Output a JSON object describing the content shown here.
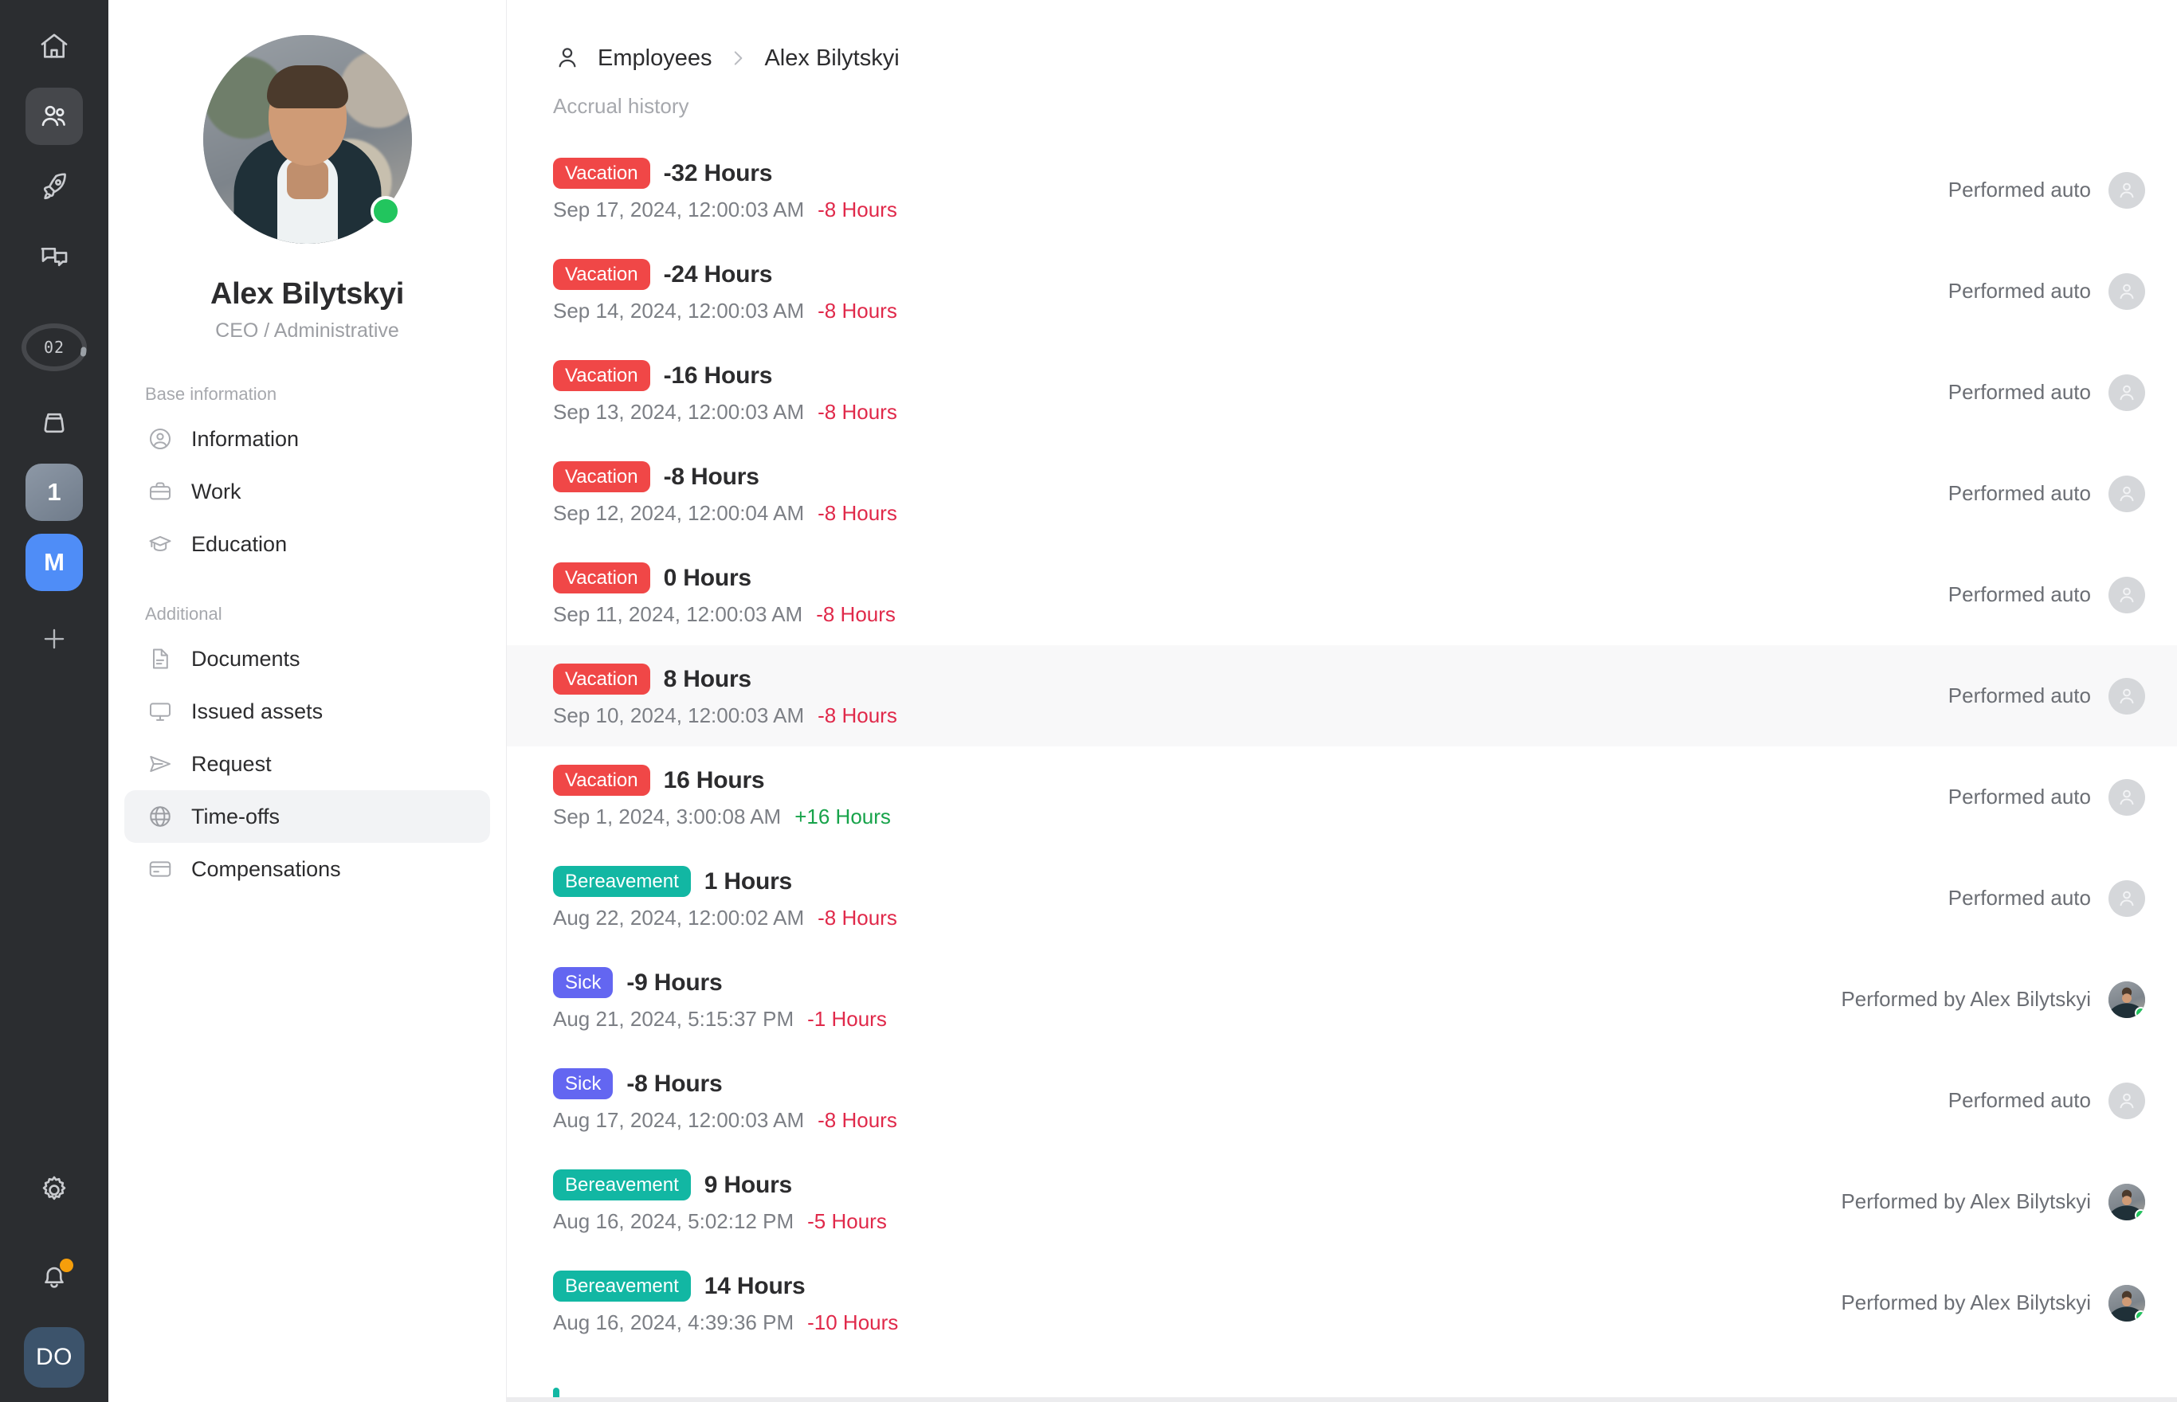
{
  "rail": {
    "items": [
      {
        "name": "home",
        "icon": "home-icon",
        "active": false
      },
      {
        "name": "employees",
        "icon": "people-icon",
        "active": true
      },
      {
        "name": "projects",
        "icon": "rocket-icon",
        "active": false
      },
      {
        "name": "chat",
        "icon": "chat-icon",
        "active": false
      }
    ],
    "ring_label": "02",
    "box_icon": "box-icon",
    "chips": [
      {
        "label": "1",
        "style": "one"
      },
      {
        "label": "M",
        "style": "m"
      }
    ],
    "add_icon": "plus-icon",
    "settings_icon": "gear-icon",
    "notifications_icon": "bell-icon",
    "notifications_badge": true,
    "user_initials": "DO"
  },
  "profile": {
    "name": "Alex Bilytskyi",
    "role": "CEO / Administrative",
    "status": "online"
  },
  "sidebar": {
    "sections": [
      {
        "title": "Base information",
        "items": [
          {
            "label": "Information",
            "icon": "user-circle-icon",
            "active": false
          },
          {
            "label": "Work",
            "icon": "briefcase-icon",
            "active": false
          },
          {
            "label": "Education",
            "icon": "graduation-cap-icon",
            "active": false
          }
        ]
      },
      {
        "title": "Additional",
        "items": [
          {
            "label": "Documents",
            "icon": "document-icon",
            "active": false
          },
          {
            "label": "Issued assets",
            "icon": "monitor-icon",
            "active": false
          },
          {
            "label": "Request",
            "icon": "send-icon",
            "active": false
          },
          {
            "label": "Time-offs",
            "icon": "globe-icon",
            "active": true
          },
          {
            "label": "Compensations",
            "icon": "card-icon",
            "active": false
          }
        ]
      }
    ]
  },
  "breadcrumb": {
    "icon": "person-icon",
    "root": "Employees",
    "separator": "chevron-right-icon",
    "current": "Alex Bilytskyi"
  },
  "main": {
    "section_title": "Accrual history",
    "rows": [
      {
        "type": "Vacation",
        "type_style": "vacation",
        "hours": "-32 Hours",
        "datetime": "Sep 17, 2024, 12:00:03 AM",
        "delta": "-8 Hours",
        "delta_sign": "neg",
        "performer": "Performed auto",
        "performer_avatar": "auto",
        "highlighted": false
      },
      {
        "type": "Vacation",
        "type_style": "vacation",
        "hours": "-24 Hours",
        "datetime": "Sep 14, 2024, 12:00:03 AM",
        "delta": "-8 Hours",
        "delta_sign": "neg",
        "performer": "Performed auto",
        "performer_avatar": "auto",
        "highlighted": false
      },
      {
        "type": "Vacation",
        "type_style": "vacation",
        "hours": "-16 Hours",
        "datetime": "Sep 13, 2024, 12:00:03 AM",
        "delta": "-8 Hours",
        "delta_sign": "neg",
        "performer": "Performed auto",
        "performer_avatar": "auto",
        "highlighted": false
      },
      {
        "type": "Vacation",
        "type_style": "vacation",
        "hours": "-8 Hours",
        "datetime": "Sep 12, 2024, 12:00:04 AM",
        "delta": "-8 Hours",
        "delta_sign": "neg",
        "performer": "Performed auto",
        "performer_avatar": "auto",
        "highlighted": false
      },
      {
        "type": "Vacation",
        "type_style": "vacation",
        "hours": "0 Hours",
        "datetime": "Sep 11, 2024, 12:00:03 AM",
        "delta": "-8 Hours",
        "delta_sign": "neg",
        "performer": "Performed auto",
        "performer_avatar": "auto",
        "highlighted": false
      },
      {
        "type": "Vacation",
        "type_style": "vacation",
        "hours": "8 Hours",
        "datetime": "Sep 10, 2024, 12:00:03 AM",
        "delta": "-8 Hours",
        "delta_sign": "neg",
        "performer": "Performed auto",
        "performer_avatar": "auto",
        "highlighted": true
      },
      {
        "type": "Vacation",
        "type_style": "vacation",
        "hours": "16 Hours",
        "datetime": "Sep 1, 2024, 3:00:08 AM",
        "delta": "+16 Hours",
        "delta_sign": "pos",
        "performer": "Performed auto",
        "performer_avatar": "auto",
        "highlighted": false
      },
      {
        "type": "Bereavement",
        "type_style": "bereavement",
        "hours": "1 Hours",
        "datetime": "Aug 22, 2024, 12:00:02 AM",
        "delta": "-8 Hours",
        "delta_sign": "neg",
        "performer": "Performed auto",
        "performer_avatar": "auto",
        "highlighted": false
      },
      {
        "type": "Sick",
        "type_style": "sick",
        "hours": "-9 Hours",
        "datetime": "Aug 21, 2024, 5:15:37 PM",
        "delta": "-1 Hours",
        "delta_sign": "neg",
        "performer": "Performed by Alex Bilytskyi",
        "performer_avatar": "photo",
        "highlighted": false
      },
      {
        "type": "Sick",
        "type_style": "sick",
        "hours": "-8 Hours",
        "datetime": "Aug 17, 2024, 12:00:03 AM",
        "delta": "-8 Hours",
        "delta_sign": "neg",
        "performer": "Performed auto",
        "performer_avatar": "auto",
        "highlighted": false
      },
      {
        "type": "Bereavement",
        "type_style": "bereavement",
        "hours": "9 Hours",
        "datetime": "Aug 16, 2024, 5:02:12 PM",
        "delta": "-5 Hours",
        "delta_sign": "neg",
        "performer": "Performed by Alex Bilytskyi",
        "performer_avatar": "photo",
        "highlighted": false
      },
      {
        "type": "Bereavement",
        "type_style": "bereavement",
        "hours": "14 Hours",
        "datetime": "Aug 16, 2024, 4:39:36 PM",
        "delta": "-10 Hours",
        "delta_sign": "neg",
        "performer": "Performed by Alex Bilytskyi",
        "performer_avatar": "photo",
        "highlighted": false
      }
    ]
  },
  "colors": {
    "vacation": "#f04747",
    "bereavement": "#12b7a3",
    "sick": "#6366f1",
    "negative": "#e0294a",
    "positive": "#17a34a",
    "rail_bg": "#2b2d30",
    "accent_blue": "#4f8df7",
    "online": "#22c55e",
    "notification": "#f59e0b"
  }
}
